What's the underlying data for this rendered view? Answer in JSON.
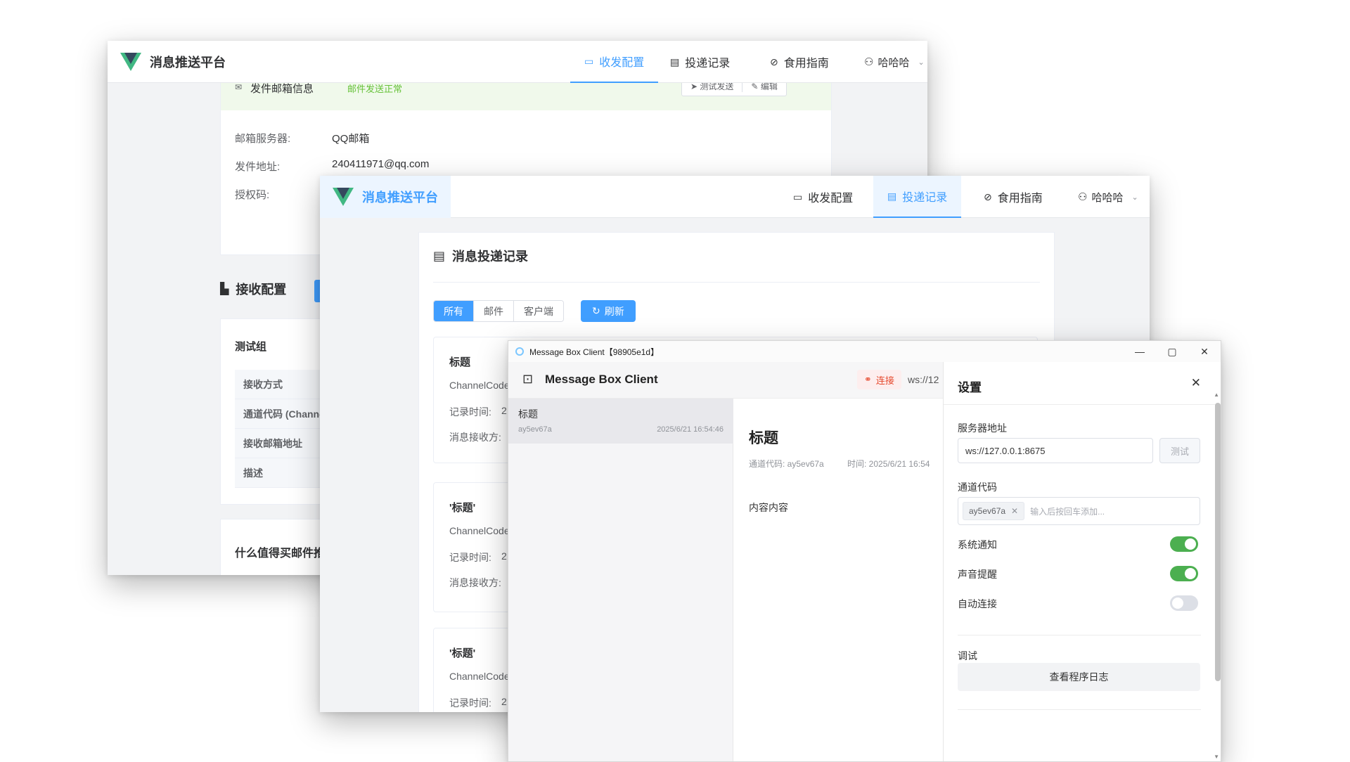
{
  "platform": {
    "brand_title": "消息推送平台",
    "nav": {
      "config": "收发配置",
      "records": "投递记录",
      "guide": "食用指南",
      "user": "哈哈哈"
    }
  },
  "window1": {
    "sender_card_title": "发件邮箱信息",
    "sender_status": "邮件发送正常",
    "test_send": "测试发送",
    "edit": "编辑",
    "server_label": "邮箱服务器:",
    "server_value": "QQ邮箱",
    "address_label": "发件地址:",
    "address_value": "240411971@qq.com",
    "auth_label": "授权码:",
    "receive_title": "接收配置",
    "group_name": "测试组",
    "table_rows": [
      "接收方式",
      "通道代码 (Channe",
      "接收邮箱地址",
      "描述"
    ],
    "section_bottom": "什么值得买邮件推"
  },
  "window2": {
    "panel_title": "消息投递记录",
    "filters": [
      "所有",
      "邮件",
      "客户端"
    ],
    "refresh": "刷新",
    "records": [
      {
        "title": "标题",
        "channel": "ChannelCode",
        "time_label": "记录时间:",
        "time_value": "2",
        "receiver_label": "消息接收方:"
      },
      {
        "title": "'标题'",
        "channel": "ChannelCode",
        "time_label": "记录时间:",
        "time_value": "2",
        "receiver_label": "消息接收方:"
      },
      {
        "title": "'标题'",
        "channel": "ChannelCode",
        "time_label": "记录时间:",
        "time_value": "2"
      }
    ]
  },
  "client": {
    "window_title": "Message Box Client【98905e1d】",
    "app_title": "Message Box Client",
    "connect": "连接",
    "ws_prefix": "ws://12",
    "message": {
      "title": "标题",
      "channel": "ay5ev67a",
      "time": "2025/6/21 16:54:46"
    },
    "detail": {
      "title": "标题",
      "channel_meta": "通道代码: ay5ev67a",
      "time_meta": "时间: 2025/6/21 16:54",
      "content": "内容内容"
    },
    "settings": {
      "title": "设置",
      "server_label": "服务器地址",
      "server_value": "ws://127.0.0.1:8675",
      "test_button": "测试",
      "channel_label": "通道代码",
      "channel_tag": "ay5ev67a",
      "channel_placeholder": "输入后按回车添加...",
      "system_notify": "系统通知",
      "sound": "声音提醒",
      "auto_connect": "自动连接",
      "debug_label": "调试",
      "view_logs": "查看程序日志",
      "toggles": {
        "system_notify": true,
        "sound": true,
        "auto_connect": false
      }
    }
  },
  "colors": {
    "accent": "#409eff",
    "success": "#67c23a",
    "toggle_on": "#4caf50",
    "danger": "#e6492d"
  }
}
